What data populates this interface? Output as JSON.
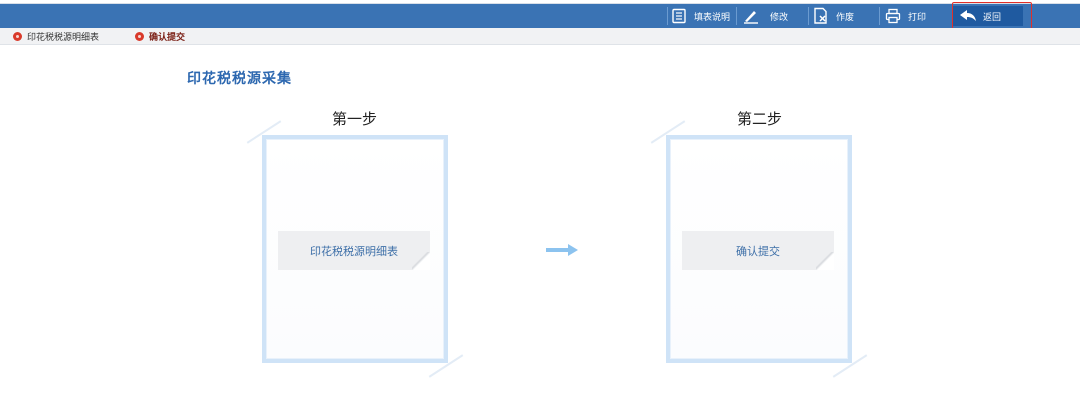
{
  "toolbar": {
    "buttons": [
      {
        "label": "填表说明",
        "icon": "document-lines-icon"
      },
      {
        "label": "修改",
        "icon": "pencil-icon"
      },
      {
        "label": "作废",
        "icon": "document-x-icon"
      },
      {
        "label": "打印",
        "icon": "printer-icon"
      },
      {
        "label": "返回",
        "icon": "return-arrow-icon"
      }
    ],
    "highlight_color": "#e0302a",
    "bar_color": "#3a73b4"
  },
  "subtabs": [
    {
      "label": "印花税税源明细表",
      "icon": "gear-icon"
    },
    {
      "label": "确认提交",
      "icon": "gear-icon"
    }
  ],
  "page": {
    "title": "印花税税源采集"
  },
  "steps": [
    {
      "label": "第一步",
      "button": "印花税税源明细表"
    },
    {
      "label": "第二步",
      "button": "确认提交"
    }
  ],
  "colors": {
    "accent": "#2d68b0",
    "arrow": "#8cc3ef",
    "card_border": "#cfe3f7"
  }
}
